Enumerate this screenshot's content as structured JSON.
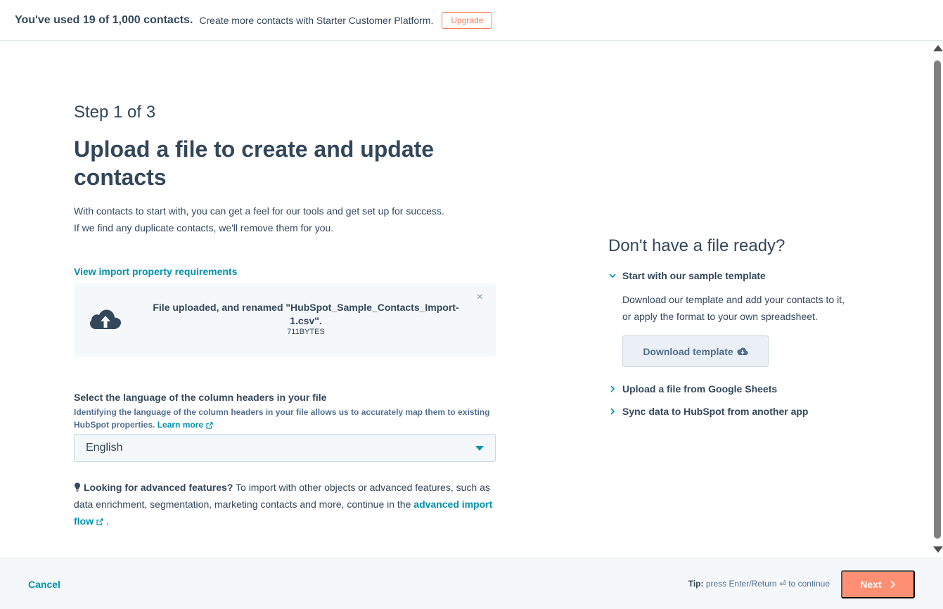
{
  "banner": {
    "usage_text": "You've used 19 of 1,000 contacts.",
    "promo_text": "Create more contacts with Starter Customer Platform.",
    "upgrade_label": "Upgrade"
  },
  "main": {
    "step_label": "Step 1 of 3",
    "title": "Upload a file to create and update contacts",
    "intro_line1": "With contacts to start with, you can get a feel for our tools and get set up for success.",
    "intro_line2": "If we find any duplicate contacts, we'll remove them for you.",
    "requirements_link": "View import property requirements",
    "upload": {
      "message": "File uploaded, and renamed \"HubSpot_Sample_Contacts_Import-1.csv\".",
      "size": "711BYTES",
      "icon": "cloud-upload-icon",
      "close_icon": "×"
    },
    "language": {
      "label": "Select the language of the column headers in your file",
      "help": "Identifying the language of the column headers in your file allows us to accurately map them to existing HubSpot properties.",
      "learn_more": "Learn more",
      "selected": "English"
    },
    "advanced": {
      "lead": "Looking for advanced features?",
      "text": "To import with other objects or advanced features, such as data enrichment, segmentation, marketing contacts and more, continue in the",
      "link": "advanced import flow",
      "end": "."
    }
  },
  "sidebar": {
    "title": "Don't have a file ready?",
    "items": [
      {
        "label": "Start with our sample template",
        "expanded": true,
        "body": "Download our template and add your contacts to it, or apply the format to your own spreadsheet.",
        "button": "Download template"
      },
      {
        "label": "Upload a file from Google Sheets",
        "expanded": false
      },
      {
        "label": "Sync data to HubSpot from another app",
        "expanded": false
      }
    ]
  },
  "footer": {
    "cancel_label": "Cancel",
    "tip_label": "Tip:",
    "tip_text": "press Enter/Return ⏎ to continue",
    "next_label": "Next"
  },
  "colors": {
    "accent": "#0091ae",
    "upgrade": "#ff7a59",
    "next_button": "#ff8f73",
    "text": "#33475b"
  }
}
